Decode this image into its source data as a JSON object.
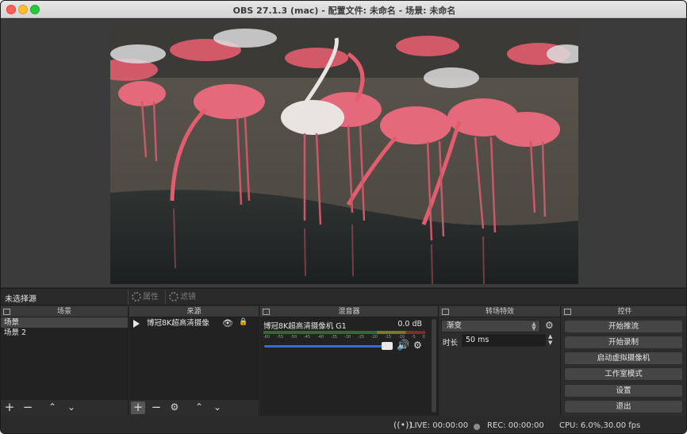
{
  "window": {
    "title": "OBS 27.1.3 (mac) - 配置文件: 未命名 - 场景: 未命名"
  },
  "source_bar": {
    "no_source": "未选择源",
    "properties": "属性",
    "filters": "滤镜"
  },
  "scenes": {
    "title": "场景",
    "items": [
      "场景",
      "场景 2"
    ]
  },
  "sources": {
    "title": "来源",
    "items": [
      {
        "name": "博冠8K超高清摄像"
      }
    ]
  },
  "mixer": {
    "title": "混音器",
    "device": "博冠8K超高清摄像机 G1",
    "level": "0.0 dB",
    "ticks": [
      "-60",
      "-55",
      "-50",
      "-45",
      "-40",
      "-35",
      "-30",
      "-25",
      "-20",
      "-15",
      "-10",
      "-5",
      "0"
    ],
    "volume_fraction": 0.97
  },
  "transitions": {
    "title": "转场特效",
    "selected": "渐变",
    "duration_label": "时长",
    "duration_value": "50 ms"
  },
  "controls": {
    "title": "控件",
    "buttons": [
      "开始推流",
      "开始录制",
      "启动虚拟摄像机",
      "工作室模式",
      "设置",
      "退出"
    ]
  },
  "status": {
    "live": "LIVE: 00:00:00",
    "rec": "REC: 00:00:00",
    "cpu": "CPU: 6.0%,30.00 fps"
  },
  "colors": {
    "accent": "#2f6fd6",
    "panel": "#2d2d2d",
    "list_bg": "#222222"
  }
}
